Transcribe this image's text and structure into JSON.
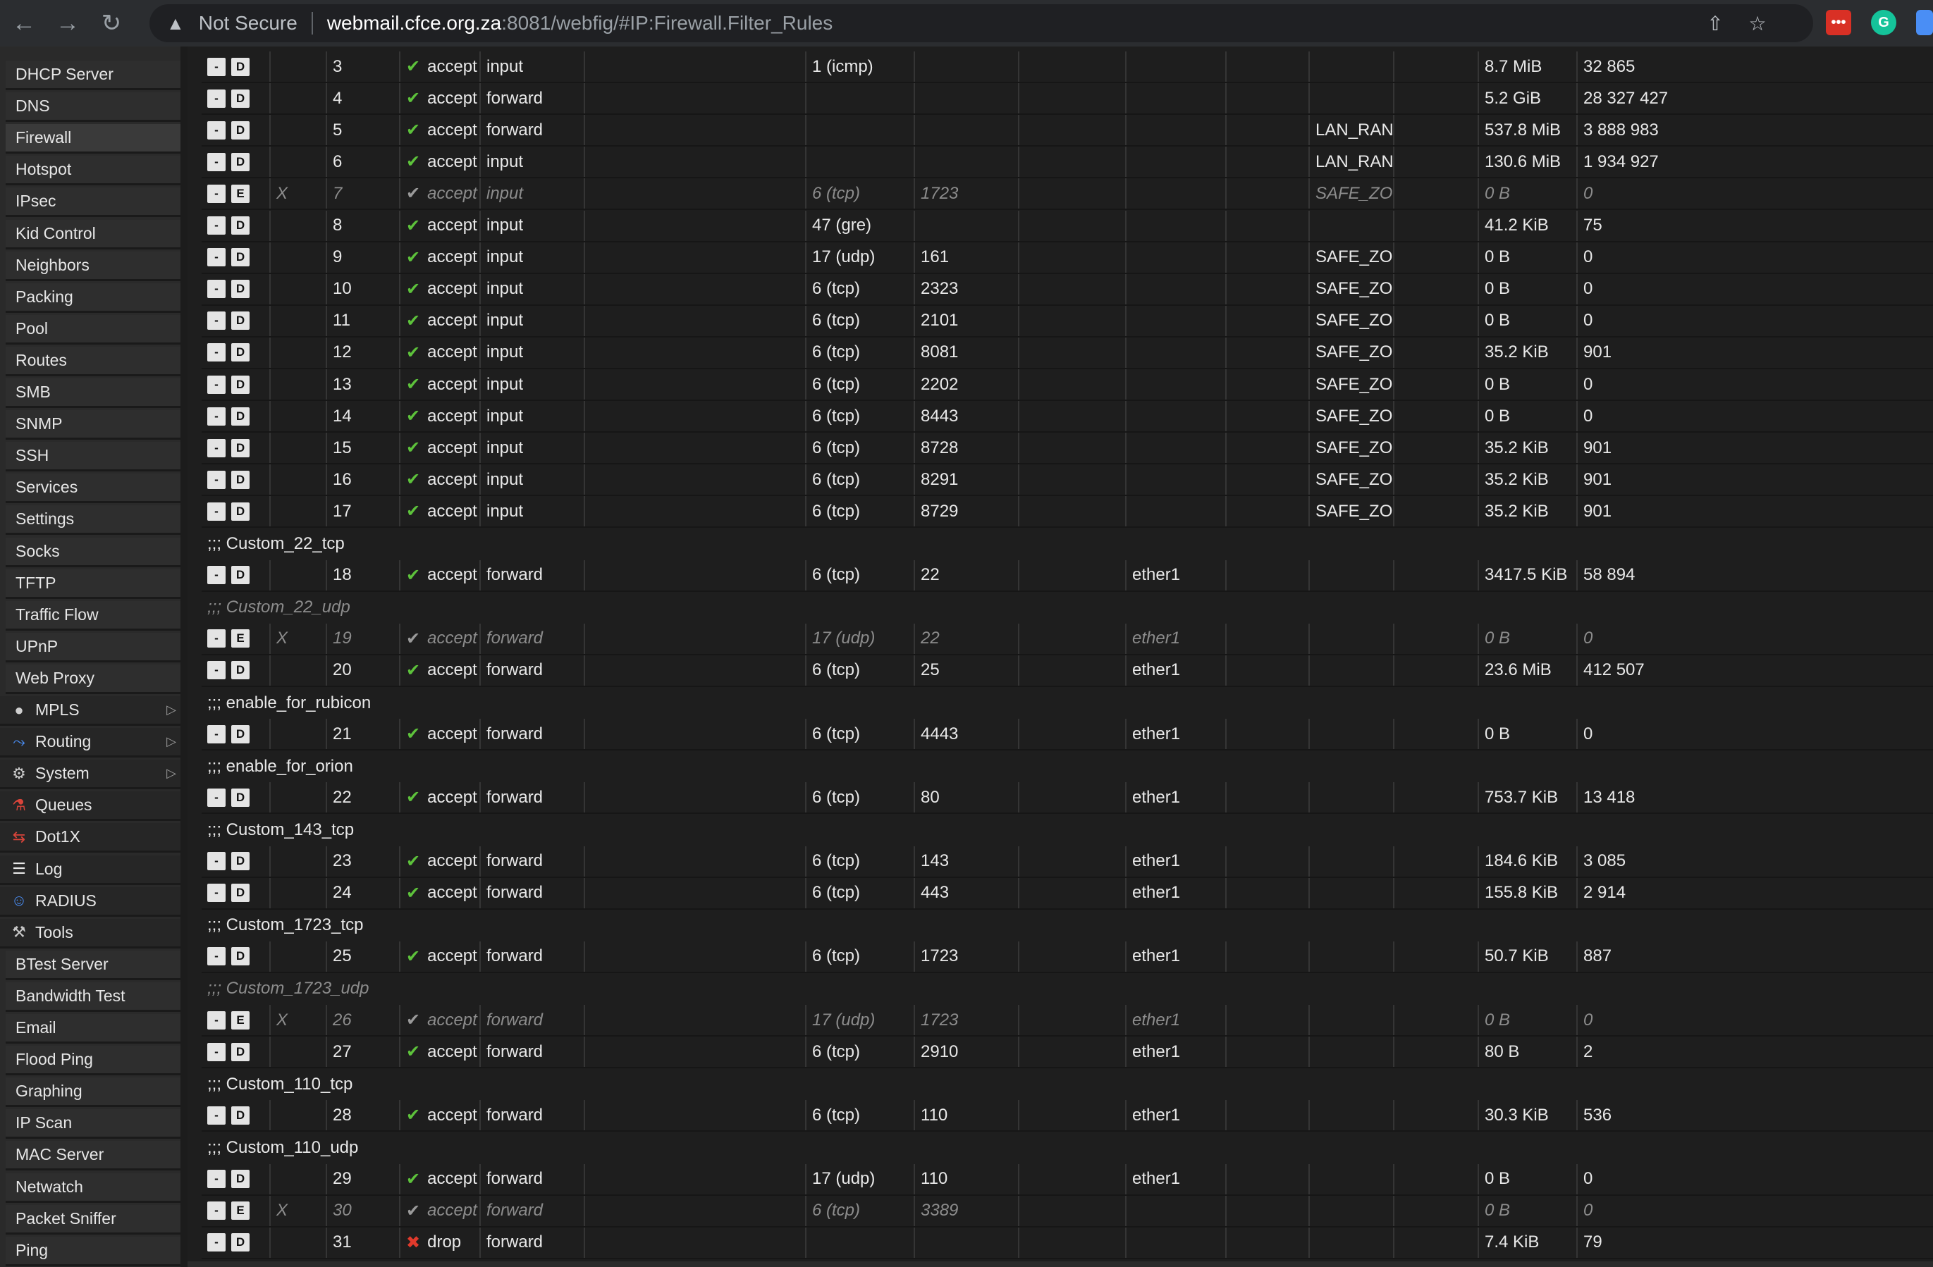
{
  "browser": {
    "not_secure": "Not Secure",
    "url_host": "webmail.cfce.org.za",
    "url_rest": ":8081/webfig/#IP:Firewall.Filter_Rules"
  },
  "sidebar": {
    "items": [
      "DHCP Server",
      "DNS",
      "Firewall",
      "Hotspot",
      "IPsec",
      "Kid Control",
      "Neighbors",
      "Packing",
      "Pool",
      "Routes",
      "SMB",
      "SNMP",
      "SSH",
      "Services",
      "Settings",
      "Socks",
      "TFTP",
      "Traffic Flow",
      "UPnP",
      "Web Proxy"
    ],
    "active_item": "Firewall",
    "top_items": [
      {
        "label": "MPLS",
        "icon": "mpls-icon",
        "submenu": true
      },
      {
        "label": "Routing",
        "icon": "routing-icon",
        "submenu": true
      },
      {
        "label": "System",
        "icon": "gear-icon",
        "submenu": true
      },
      {
        "label": "Queues",
        "icon": "queues-icon",
        "submenu": false
      },
      {
        "label": "Dot1X",
        "icon": "dot1x-icon",
        "submenu": false
      },
      {
        "label": "Log",
        "icon": "log-icon",
        "submenu": false
      },
      {
        "label": "RADIUS",
        "icon": "radius-icon",
        "submenu": false
      },
      {
        "label": "Tools",
        "icon": "tools-icon",
        "submenu": false
      }
    ],
    "tools_items": [
      "BTest Server",
      "Bandwidth Test",
      "Email",
      "Flood Ping",
      "Graphing",
      "IP Scan",
      "MAC Server",
      "Netwatch",
      "Packet Sniffer",
      "Ping"
    ]
  },
  "rules": [
    {
      "kind": "rule",
      "toggle": "D",
      "num": "3",
      "action": "accept",
      "chain": "input",
      "protocol": "1 (icmp)",
      "port": "",
      "iface": "",
      "list": "",
      "bytes": "8.7 MiB",
      "packets": "32 865"
    },
    {
      "kind": "rule",
      "toggle": "D",
      "num": "4",
      "action": "accept",
      "chain": "forward",
      "protocol": "",
      "port": "",
      "iface": "",
      "list": "",
      "bytes": "5.2 GiB",
      "packets": "28 327 427"
    },
    {
      "kind": "rule",
      "toggle": "D",
      "num": "5",
      "action": "accept",
      "chain": "forward",
      "protocol": "",
      "port": "",
      "iface": "",
      "list": "LAN_RAN(",
      "bytes": "537.8 MiB",
      "packets": "3 888 983"
    },
    {
      "kind": "rule",
      "toggle": "D",
      "num": "6",
      "action": "accept",
      "chain": "input",
      "protocol": "",
      "port": "",
      "iface": "",
      "list": "LAN_RAN(",
      "bytes": "130.6 MiB",
      "packets": "1 934 927"
    },
    {
      "kind": "rule",
      "toggle": "E",
      "disabled": true,
      "flag": "X",
      "num": "7",
      "action": "accept",
      "chain": "input",
      "protocol": "6 (tcp)",
      "port": "1723",
      "iface": "",
      "list": "SAFE_ZOI",
      "bytes": "0 B",
      "packets": "0"
    },
    {
      "kind": "rule",
      "toggle": "D",
      "num": "8",
      "action": "accept",
      "chain": "input",
      "protocol": "47 (gre)",
      "port": "",
      "iface": "",
      "list": "",
      "bytes": "41.2 KiB",
      "packets": "75"
    },
    {
      "kind": "rule",
      "toggle": "D",
      "num": "9",
      "action": "accept",
      "chain": "input",
      "protocol": "17 (udp)",
      "port": "161",
      "iface": "",
      "list": "SAFE_ZOI",
      "bytes": "0 B",
      "packets": "0"
    },
    {
      "kind": "rule",
      "toggle": "D",
      "num": "10",
      "action": "accept",
      "chain": "input",
      "protocol": "6 (tcp)",
      "port": "2323",
      "iface": "",
      "list": "SAFE_ZOI",
      "bytes": "0 B",
      "packets": "0"
    },
    {
      "kind": "rule",
      "toggle": "D",
      "num": "11",
      "action": "accept",
      "chain": "input",
      "protocol": "6 (tcp)",
      "port": "2101",
      "iface": "",
      "list": "SAFE_ZOI",
      "bytes": "0 B",
      "packets": "0"
    },
    {
      "kind": "rule",
      "toggle": "D",
      "num": "12",
      "action": "accept",
      "chain": "input",
      "protocol": "6 (tcp)",
      "port": "8081",
      "iface": "",
      "list": "SAFE_ZOI",
      "bytes": "35.2 KiB",
      "packets": "901"
    },
    {
      "kind": "rule",
      "toggle": "D",
      "num": "13",
      "action": "accept",
      "chain": "input",
      "protocol": "6 (tcp)",
      "port": "2202",
      "iface": "",
      "list": "SAFE_ZOI",
      "bytes": "0 B",
      "packets": "0"
    },
    {
      "kind": "rule",
      "toggle": "D",
      "num": "14",
      "action": "accept",
      "chain": "input",
      "protocol": "6 (tcp)",
      "port": "8443",
      "iface": "",
      "list": "SAFE_ZOI",
      "bytes": "0 B",
      "packets": "0"
    },
    {
      "kind": "rule",
      "toggle": "D",
      "num": "15",
      "action": "accept",
      "chain": "input",
      "protocol": "6 (tcp)",
      "port": "8728",
      "iface": "",
      "list": "SAFE_ZOI",
      "bytes": "35.2 KiB",
      "packets": "901"
    },
    {
      "kind": "rule",
      "toggle": "D",
      "num": "16",
      "action": "accept",
      "chain": "input",
      "protocol": "6 (tcp)",
      "port": "8291",
      "iface": "",
      "list": "SAFE_ZOI",
      "bytes": "35.2 KiB",
      "packets": "901"
    },
    {
      "kind": "rule",
      "toggle": "D",
      "num": "17",
      "action": "accept",
      "chain": "input",
      "protocol": "6 (tcp)",
      "port": "8729",
      "iface": "",
      "list": "SAFE_ZOI",
      "bytes": "35.2 KiB",
      "packets": "901"
    },
    {
      "kind": "comment",
      "text": ";;; Custom_22_tcp"
    },
    {
      "kind": "rule",
      "toggle": "D",
      "num": "18",
      "action": "accept",
      "chain": "forward",
      "protocol": "6 (tcp)",
      "port": "22",
      "iface": "ether1",
      "list": "",
      "bytes": "3417.5 KiB",
      "packets": "58 894"
    },
    {
      "kind": "comment",
      "disabled": true,
      "text": ";;; Custom_22_udp"
    },
    {
      "kind": "rule",
      "toggle": "E",
      "disabled": true,
      "flag": "X",
      "num": "19",
      "action": "accept",
      "chain": "forward",
      "protocol": "17 (udp)",
      "port": "22",
      "iface": "ether1",
      "list": "",
      "bytes": "0 B",
      "packets": "0"
    },
    {
      "kind": "rule",
      "toggle": "D",
      "num": "20",
      "action": "accept",
      "chain": "forward",
      "protocol": "6 (tcp)",
      "port": "25",
      "iface": "ether1",
      "list": "",
      "bytes": "23.6 MiB",
      "packets": "412 507"
    },
    {
      "kind": "comment",
      "text": ";;; enable_for_rubicon"
    },
    {
      "kind": "rule",
      "toggle": "D",
      "num": "21",
      "action": "accept",
      "chain": "forward",
      "protocol": "6 (tcp)",
      "port": "4443",
      "iface": "ether1",
      "list": "",
      "bytes": "0 B",
      "packets": "0"
    },
    {
      "kind": "comment",
      "text": ";;; enable_for_orion"
    },
    {
      "kind": "rule",
      "toggle": "D",
      "num": "22",
      "action": "accept",
      "chain": "forward",
      "protocol": "6 (tcp)",
      "port": "80",
      "iface": "ether1",
      "list": "",
      "bytes": "753.7 KiB",
      "packets": "13 418"
    },
    {
      "kind": "comment",
      "text": ";;; Custom_143_tcp"
    },
    {
      "kind": "rule",
      "toggle": "D",
      "num": "23",
      "action": "accept",
      "chain": "forward",
      "protocol": "6 (tcp)",
      "port": "143",
      "iface": "ether1",
      "list": "",
      "bytes": "184.6 KiB",
      "packets": "3 085"
    },
    {
      "kind": "rule",
      "toggle": "D",
      "num": "24",
      "action": "accept",
      "chain": "forward",
      "protocol": "6 (tcp)",
      "port": "443",
      "iface": "ether1",
      "list": "",
      "bytes": "155.8 KiB",
      "packets": "2 914"
    },
    {
      "kind": "comment",
      "text": ";;; Custom_1723_tcp"
    },
    {
      "kind": "rule",
      "toggle": "D",
      "num": "25",
      "action": "accept",
      "chain": "forward",
      "protocol": "6 (tcp)",
      "port": "1723",
      "iface": "ether1",
      "list": "",
      "bytes": "50.7 KiB",
      "packets": "887"
    },
    {
      "kind": "comment",
      "disabled": true,
      "text": ";;; Custom_1723_udp"
    },
    {
      "kind": "rule",
      "toggle": "E",
      "disabled": true,
      "flag": "X",
      "num": "26",
      "action": "accept",
      "chain": "forward",
      "protocol": "17 (udp)",
      "port": "1723",
      "iface": "ether1",
      "list": "",
      "bytes": "0 B",
      "packets": "0"
    },
    {
      "kind": "rule",
      "toggle": "D",
      "num": "27",
      "action": "accept",
      "chain": "forward",
      "protocol": "6 (tcp)",
      "port": "2910",
      "iface": "ether1",
      "list": "",
      "bytes": "80 B",
      "packets": "2"
    },
    {
      "kind": "comment",
      "text": ";;; Custom_110_tcp"
    },
    {
      "kind": "rule",
      "toggle": "D",
      "num": "28",
      "action": "accept",
      "chain": "forward",
      "protocol": "6 (tcp)",
      "port": "110",
      "iface": "ether1",
      "list": "",
      "bytes": "30.3 KiB",
      "packets": "536"
    },
    {
      "kind": "comment",
      "text": ";;; Custom_110_udp"
    },
    {
      "kind": "rule",
      "toggle": "D",
      "num": "29",
      "action": "accept",
      "chain": "forward",
      "protocol": "17 (udp)",
      "port": "110",
      "iface": "ether1",
      "list": "",
      "bytes": "0 B",
      "packets": "0"
    },
    {
      "kind": "rule",
      "toggle": "E",
      "disabled": true,
      "flag": "X",
      "num": "30",
      "action": "accept",
      "chain": "forward",
      "protocol": "6 (tcp)",
      "port": "3389",
      "iface": "",
      "list": "",
      "bytes": "0 B",
      "packets": "0"
    },
    {
      "kind": "rule",
      "toggle": "D",
      "num": "31",
      "action": "drop",
      "chain": "forward",
      "protocol": "",
      "port": "",
      "iface": "",
      "list": "",
      "bytes": "7.4 KiB",
      "packets": "79"
    }
  ],
  "colors": {
    "accept": "#5dc23b",
    "drop": "#e03a2c",
    "disabled": "#8c8c8c"
  }
}
